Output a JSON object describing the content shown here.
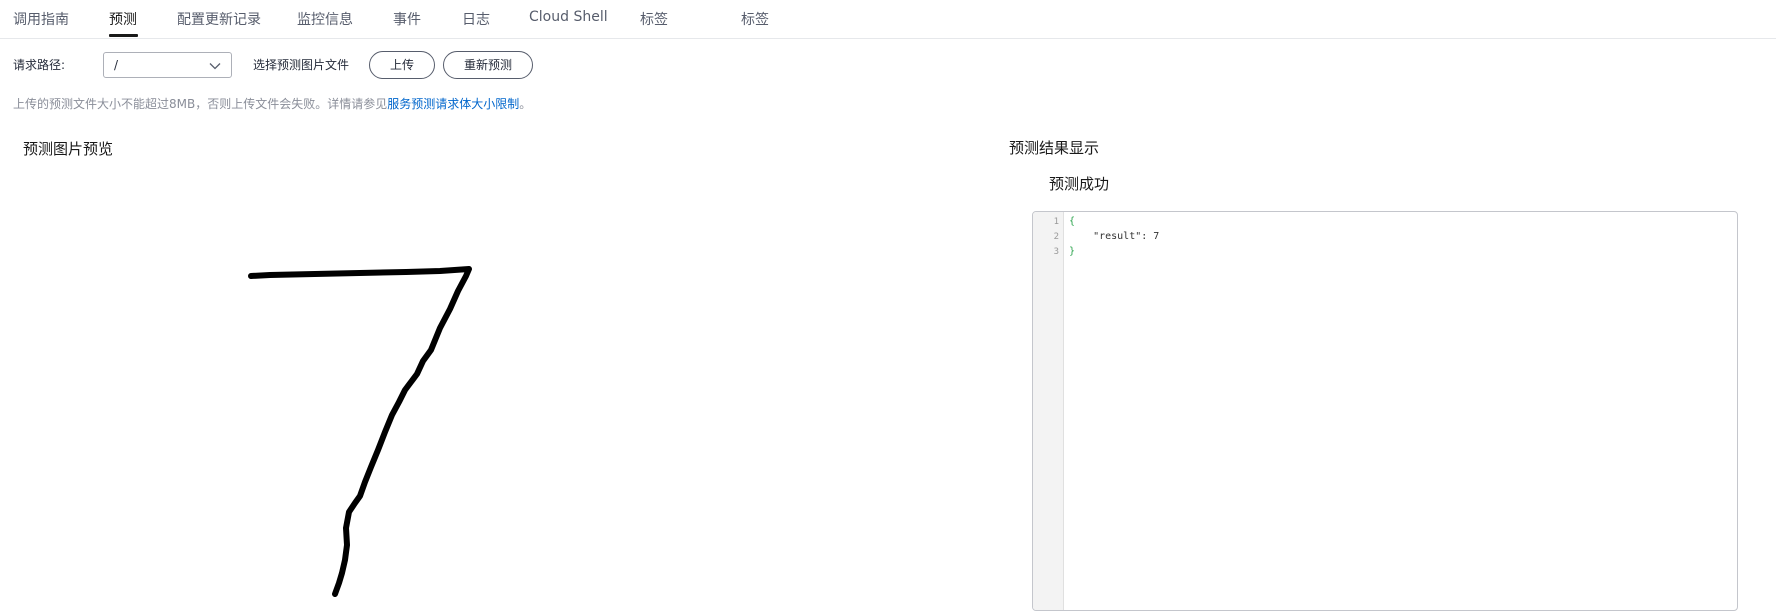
{
  "tabs": [
    {
      "label": "调用指南"
    },
    {
      "label": "预测",
      "active": true
    },
    {
      "label": "配置更新记录"
    },
    {
      "label": "监控信息"
    },
    {
      "label": "事件"
    },
    {
      "label": "日志"
    },
    {
      "label": "Cloud Shell"
    },
    {
      "label": "标签"
    },
    {
      "label": "标签"
    }
  ],
  "toolbar": {
    "path_label": "请求路径:",
    "path_value": "/",
    "file_label": "选择预测图片文件",
    "upload_button": "上传",
    "repredict_button": "重新预测"
  },
  "hint": {
    "text": "上传的预测文件大小不能超过8MB，否则上传文件会失败。详情请参见",
    "link": "服务预测请求体大小限制",
    "suffix": "。"
  },
  "preview": {
    "title": "预测图片预览",
    "digit": "7"
  },
  "result": {
    "title": "预测结果显示",
    "status": "预测成功",
    "code_lines": [
      {
        "num": "1",
        "text": "{"
      },
      {
        "num": "2",
        "text": "    \"result\": 7"
      },
      {
        "num": "3",
        "text": "}"
      }
    ]
  },
  "colors": {
    "link": "#0066cc",
    "brace": "#2da44e"
  }
}
